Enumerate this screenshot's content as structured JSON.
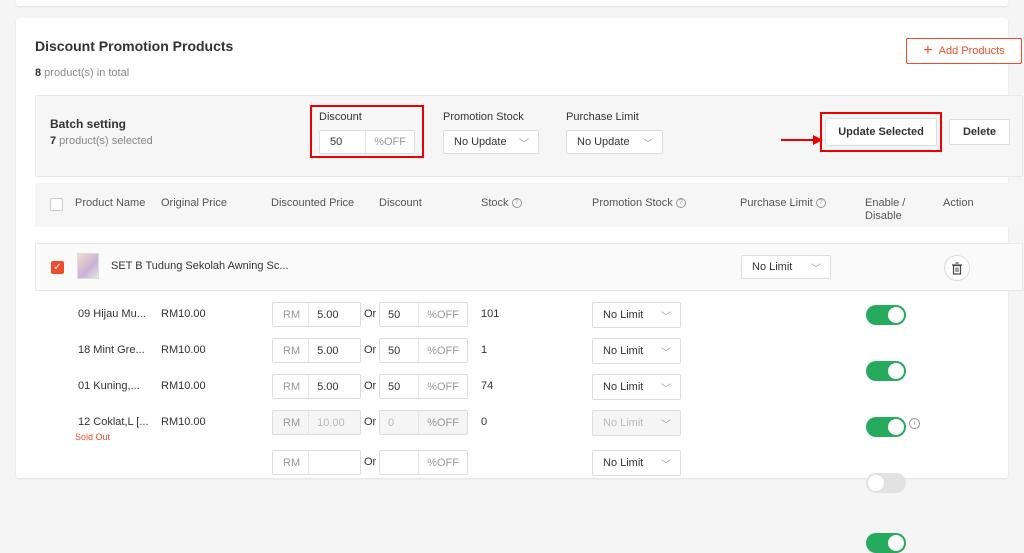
{
  "section": {
    "title": "Discount Promotion Products",
    "count": "8",
    "count_suffix": " product(s) in total",
    "add_button": "Add Products"
  },
  "batch": {
    "title": "Batch setting",
    "selected_count": "7",
    "selected_suffix": " product(s) selected",
    "discount_label": "Discount",
    "discount_value": "50",
    "discount_suffix": "%OFF",
    "promo_stock_label": "Promotion Stock",
    "promo_stock_value": "No Update",
    "purchase_limit_label": "Purchase Limit",
    "purchase_limit_value": "No Update",
    "update_button": "Update Selected",
    "delete_button": "Delete"
  },
  "table": {
    "headers": {
      "product_name": "Product Name",
      "original_price": "Original Price",
      "discounted_price": "Discounted Price",
      "discount": "Discount",
      "stock": "Stock",
      "promotion_stock": "Promotion Stock",
      "purchase_limit": "Purchase Limit",
      "enable_disable_1": "Enable /",
      "enable_disable_2": "Disable",
      "action": "Action"
    },
    "product": {
      "name": "SET B Tudung Sekolah Awning Sc...",
      "limit": "No Limit"
    },
    "currency": "RM",
    "or_label": "Or",
    "off_label": "%OFF",
    "variations": [
      {
        "name": "09 Hijau Mu...",
        "price": "RM10.00",
        "disc_price": "5.00",
        "disc": "50",
        "stock": "101",
        "limit": "No Limit",
        "enabled": true,
        "sold_out": ""
      },
      {
        "name": "18 Mint Gre...",
        "price": "RM10.00",
        "disc_price": "5.00",
        "disc": "50",
        "stock": "1",
        "limit": "No Limit",
        "enabled": true,
        "sold_out": ""
      },
      {
        "name": "01 Kuning,...",
        "price": "RM10.00",
        "disc_price": "5.00",
        "disc": "50",
        "stock": "74",
        "limit": "No Limit",
        "enabled": true,
        "sold_out": ""
      },
      {
        "name": "12 Coklat,L [...",
        "price": "RM10.00",
        "disc_price": "10.00",
        "disc": "0",
        "stock": "0",
        "limit": "No Limit",
        "enabled": false,
        "sold_out": "Sold Out"
      },
      {
        "name": "",
        "price": "",
        "disc_price": "",
        "disc": "",
        "stock": "",
        "limit": "No Limit",
        "enabled": true,
        "sold_out": ""
      }
    ]
  },
  "colors": {
    "accent": "#ee4d2d",
    "toggle_on": "#26aa5d",
    "annotation_red": "#e00000"
  }
}
